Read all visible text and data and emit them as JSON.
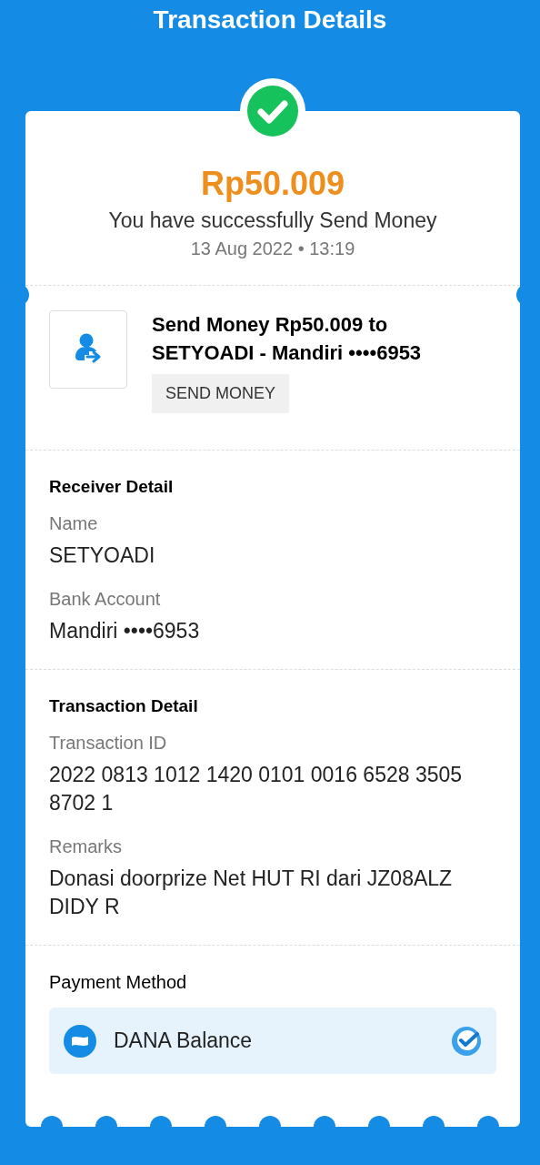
{
  "header": {
    "title": "Transaction Details"
  },
  "summary": {
    "amount": "Rp50.009",
    "message": "You have successfully Send Money",
    "datetime": "13 Aug 2022 • 13:19"
  },
  "transaction": {
    "description": "Send Money Rp50.009 to SETYOADI - Mandiri ••••6953",
    "category": "SEND MONEY"
  },
  "receiver_detail": {
    "heading": "Receiver Detail",
    "fields": [
      {
        "label": "Name",
        "value": "SETYOADI"
      },
      {
        "label": "Bank Account",
        "value": "Mandiri ••••6953"
      }
    ]
  },
  "transaction_detail": {
    "heading": "Transaction Detail",
    "fields": [
      {
        "label": "Transaction ID",
        "value": "2022 0813 1012 1420 0101 0016 6528 3505 8702 1"
      },
      {
        "label": "Remarks",
        "value": "Donasi doorprize Net HUT RI dari JZ08ALZ DIDY R"
      }
    ]
  },
  "payment_method": {
    "heading": "Payment Method",
    "method": {
      "name": "DANA Balance",
      "selected": true
    }
  }
}
